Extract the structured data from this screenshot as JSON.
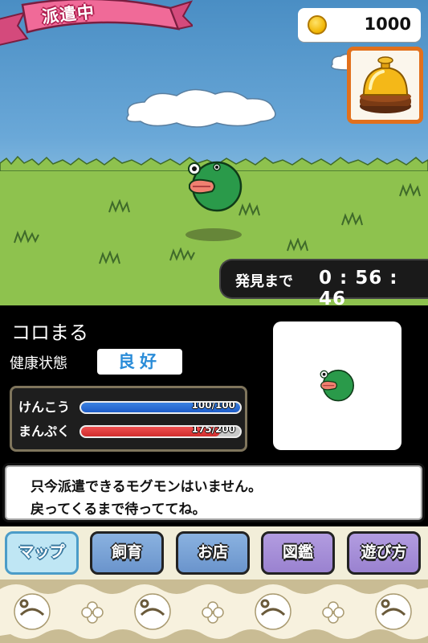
{
  "status_banner": "派遣中",
  "coins": {
    "value": "1000",
    "icon": "coin-icon"
  },
  "bell": {
    "icon": "bell-icon"
  },
  "timer": {
    "label": "発見まで",
    "value": "0 : 56 : 46"
  },
  "pet": {
    "name": "コロまる",
    "health_label": "健康状態",
    "health_value": "良好",
    "gauges": [
      {
        "label": "けんこう",
        "text": "100/100",
        "fraction": 1.0,
        "color": "#2a66d0"
      },
      {
        "label": "まんぷく",
        "text": "175/200",
        "fraction": 0.875,
        "color": "#e04040"
      }
    ]
  },
  "message": {
    "line1": "只今派遣できるモグモンはいません。",
    "line2": "戻ってくるまで待っててね。"
  },
  "nav": [
    {
      "label": "マップ",
      "style": "active"
    },
    {
      "label": "飼育",
      "style": "blue"
    },
    {
      "label": "お店",
      "style": "blue"
    },
    {
      "label": "図鑑",
      "style": "purple"
    },
    {
      "label": "遊び方",
      "style": "purple"
    }
  ],
  "colors": {
    "accent": "#e2701c",
    "banner": "#f06a98",
    "grass": "#8ec24e",
    "sky": "#5c9cd0"
  }
}
